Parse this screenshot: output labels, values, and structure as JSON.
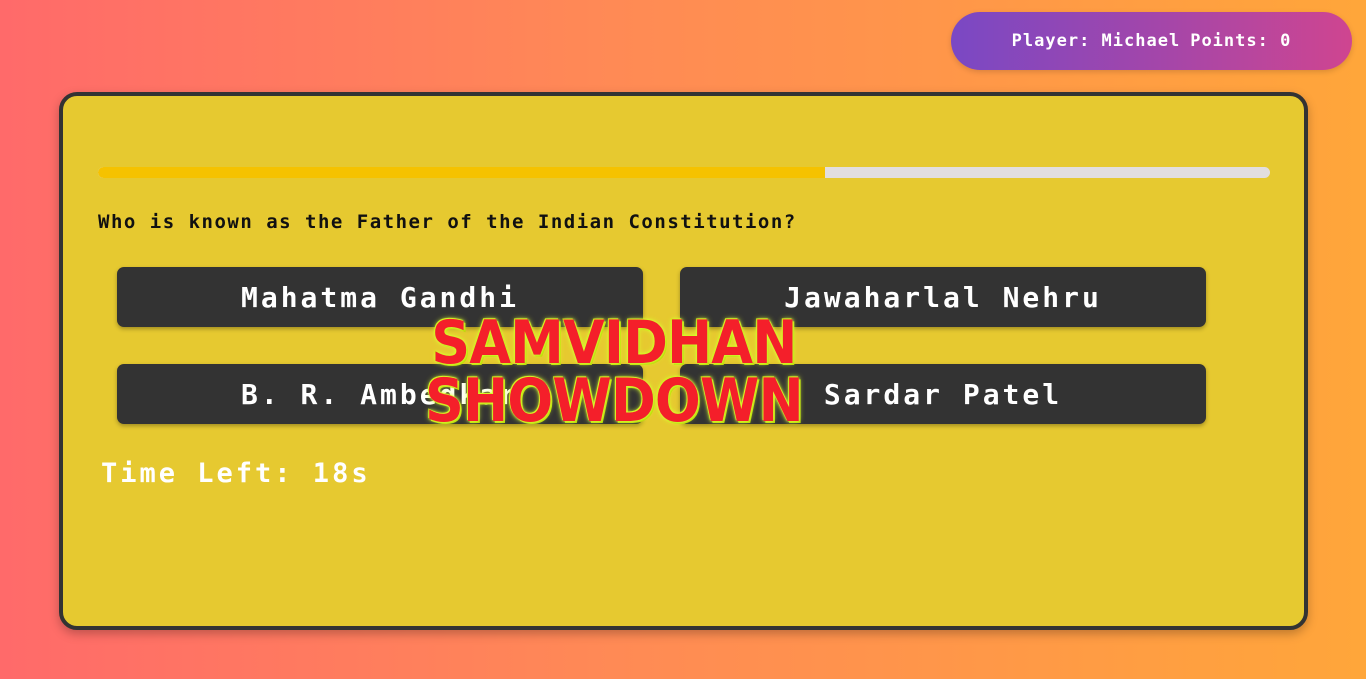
{
  "header": {
    "player_label": "Player: Michael",
    "points_label": "Points: 0"
  },
  "quiz": {
    "progress_percent": 62,
    "question": "Who is known as the Father of the Indian Constitution?",
    "options": [
      "Mahatma Gandhi",
      "Jawaharlal Nehru",
      "B. R. Ambedkar",
      "Sardar Patel"
    ],
    "timer_label": "Time Left: 18s"
  },
  "logo": {
    "line1": "SAMVIDHAN",
    "line2": "SHOWDOWN"
  },
  "colors": {
    "card_background": "#e6c930",
    "progress_fill": "#f5c200",
    "logo_red": "#f41f2a",
    "logo_glow": "#d8ff2a",
    "button_background": "#333333"
  }
}
